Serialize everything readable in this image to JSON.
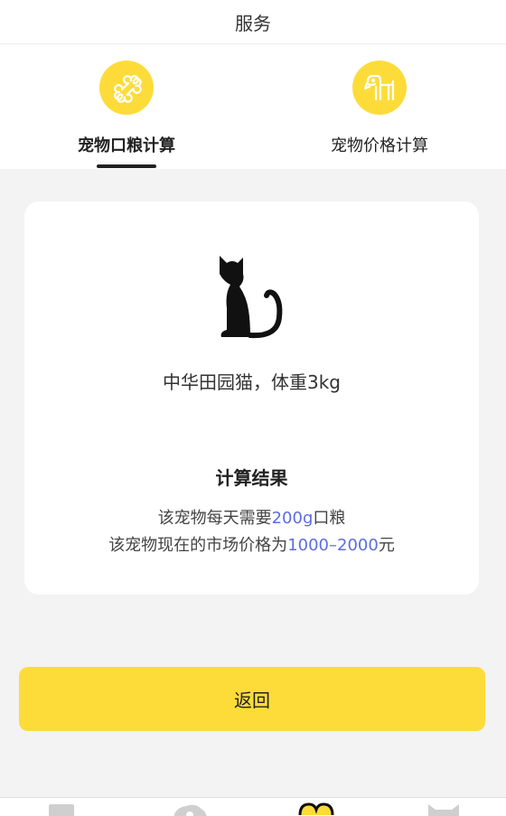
{
  "header": {
    "title": "服务"
  },
  "tabs": [
    {
      "label": "宠物口粮计算",
      "icon": "bone-icon",
      "active": true
    },
    {
      "label": "宠物价格计算",
      "icon": "dog-icon",
      "active": false
    }
  ],
  "card": {
    "icon": "cat-icon",
    "pet_description": "中华田园猫，体重3kg",
    "result_title": "计算结果",
    "food_prefix": "该宠物每天需要",
    "food_amount": "200g",
    "food_suffix": "口粮",
    "price_prefix": "该宠物现在的市场价格为",
    "price_range": "1000–2000",
    "price_suffix": "元"
  },
  "back_button": {
    "label": "返回"
  },
  "bottom_nav": {
    "items": [
      "home-icon",
      "cloud-icon",
      "heart-icon",
      "cat-face-icon"
    ]
  },
  "colors": {
    "accent": "#fddc3a",
    "highlight": "#5b6ee0"
  }
}
